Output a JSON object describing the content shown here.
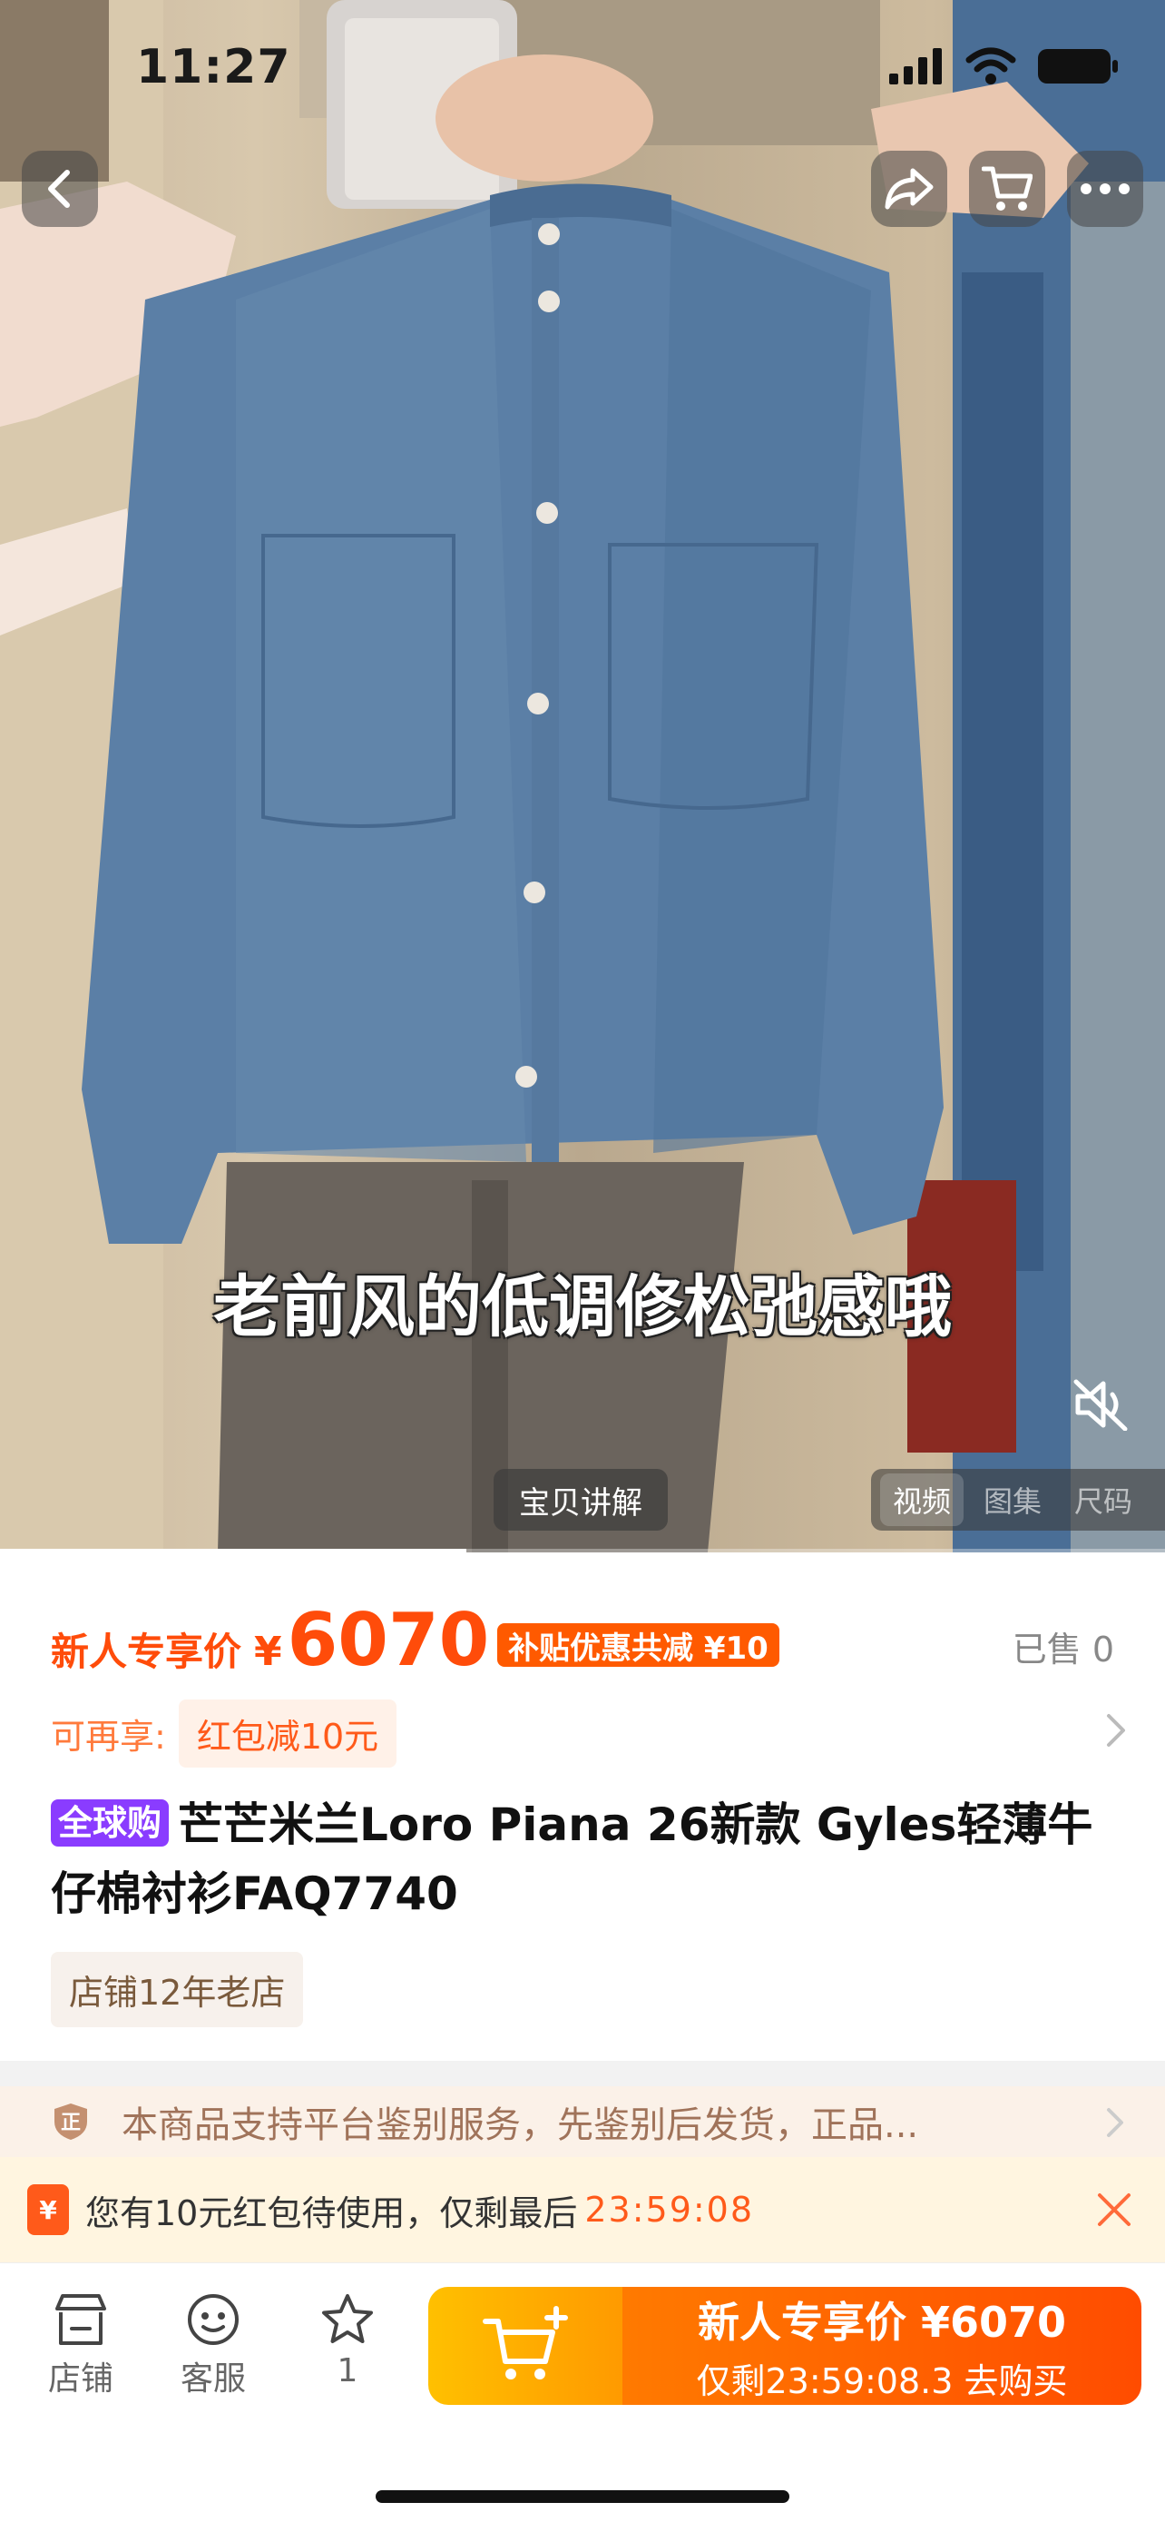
{
  "status_bar": {
    "time": "11:27"
  },
  "header": {
    "back_icon": "chevron-left-icon",
    "share_icon": "share-icon",
    "cart_icon": "cart-icon",
    "more_icon": "more-icon"
  },
  "media": {
    "subtitle": "老前风的低调修松弛感哦",
    "explain_label": "宝贝讲解",
    "tabs": [
      {
        "label": "视频",
        "active": true
      },
      {
        "label": "图集",
        "active": false
      },
      {
        "label": "尺码",
        "active": false
      }
    ],
    "progress_fraction": 0.4
  },
  "product": {
    "price_label": "新人专享价",
    "currency": "¥",
    "price": "6070",
    "subsidy_tag": "补贴优惠共减 ¥10",
    "sold_text": "已售 0",
    "extra_label": "可再享:",
    "coupon_tag": "红包减10元",
    "badge": "全球购",
    "title": "芒芒米兰Loro Piana 26新款 Gyles轻薄牛仔棉衬衫FAQ7740",
    "shop_age": "店铺12年老店"
  },
  "auth_notice": {
    "icon_glyph": "正",
    "text": "本商品支持平台鉴别服务，先鉴别后发货，正品..."
  },
  "packet_bar": {
    "icon_glyph": "¥",
    "text": "您有10元红包待使用，仅剩最后",
    "countdown": "23:59:08"
  },
  "bottom_bar": {
    "shop_label": "店铺",
    "service_label": "客服",
    "favorite_count": "1",
    "buy_line1": "新人专享价 ¥6070",
    "buy_line2": "仅剩23:59:08.3 去购买"
  },
  "colors": {
    "accent": "#ff4c0a",
    "badge": "#8a3cff",
    "buy_gradient_start": "#ff7a00",
    "cart_gradient_start": "#ffc000"
  }
}
